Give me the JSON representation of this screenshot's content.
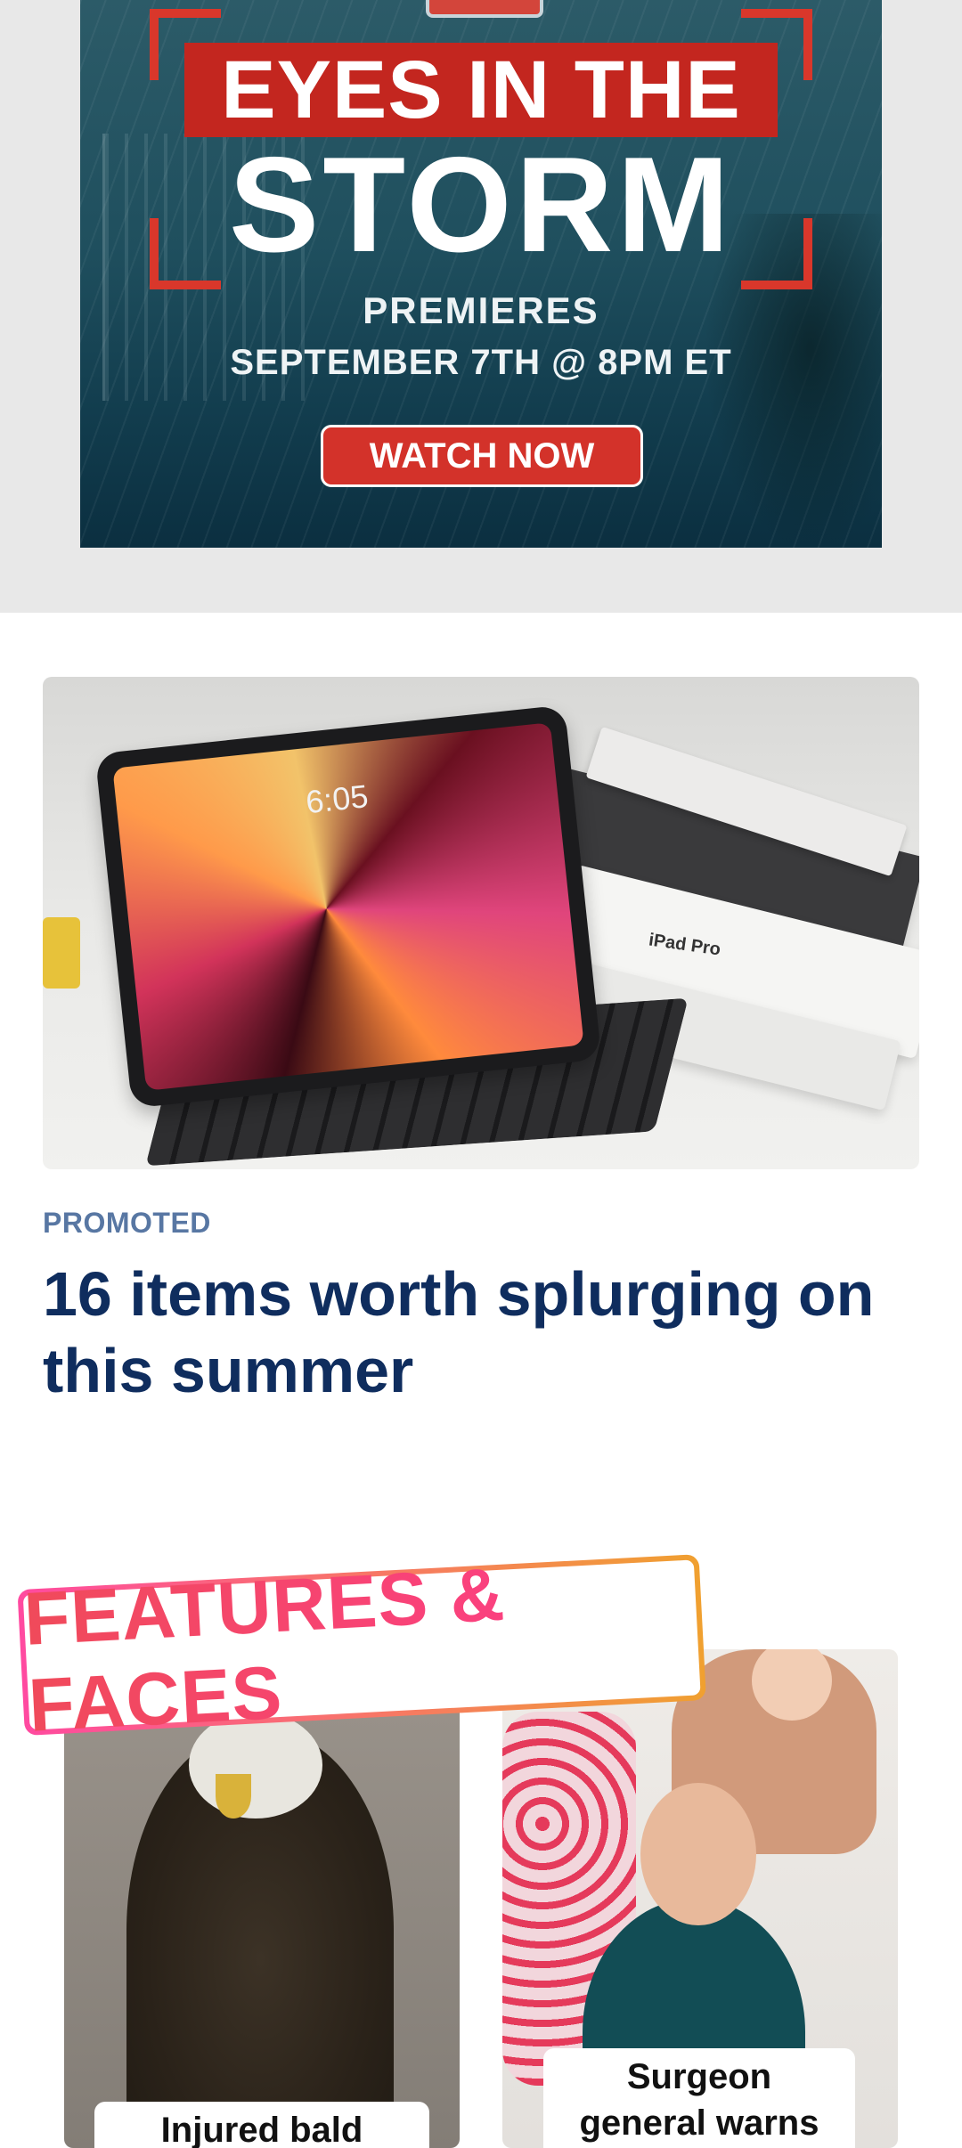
{
  "ad": {
    "title_line1": "EYES IN THE",
    "title_line2": "STORM",
    "subtitle_line1": "PREMIERES",
    "subtitle_line2": "SEPTEMBER 7TH @ 8PM ET",
    "cta_label": "WATCH NOW",
    "colors": {
      "accent_red": "#c3261f",
      "background_teal": "#1f4f5e"
    }
  },
  "promo": {
    "label": "PROMOTED",
    "title": "16 items worth splurging on this summer",
    "image": {
      "screen_time": "6:05",
      "box_label": "iPad Pro"
    },
    "colors": {
      "label": "#5877a3",
      "title": "#0f2d5e"
    }
  },
  "features": {
    "heading": "FEATURES & FACES",
    "cards": [
      {
        "caption": "Injured bald eagle"
      },
      {
        "caption": "Surgeon general warns of parental"
      }
    ],
    "colors": {
      "gradient_start": "#ff4aa0",
      "gradient_end": "#f0a030"
    }
  }
}
